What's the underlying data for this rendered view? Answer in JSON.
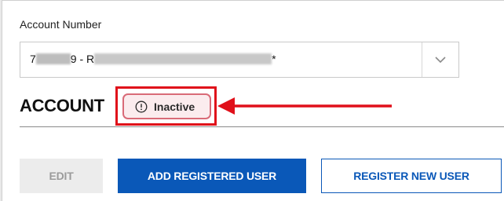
{
  "account": {
    "field_label": "Account Number",
    "selected_prefix": "7",
    "selected_middle": "9 - R",
    "selected_suffix": "*",
    "dropdown_icon": "chevron-down-icon"
  },
  "section": {
    "title": "ACCOUNT",
    "status_label": "Inactive",
    "status_icon": "exclamation-circle-icon"
  },
  "actions": {
    "edit_label": "EDIT",
    "add_registered_user_label": "ADD REGISTERED USER",
    "register_new_user_label": "REGISTER NEW USER"
  },
  "colors": {
    "primary_blue": "#0a58b8",
    "annotation_red": "#e0101a",
    "badge_border": "#d96b78",
    "badge_fill": "#fbecee",
    "disabled_gray": "#ececec"
  }
}
